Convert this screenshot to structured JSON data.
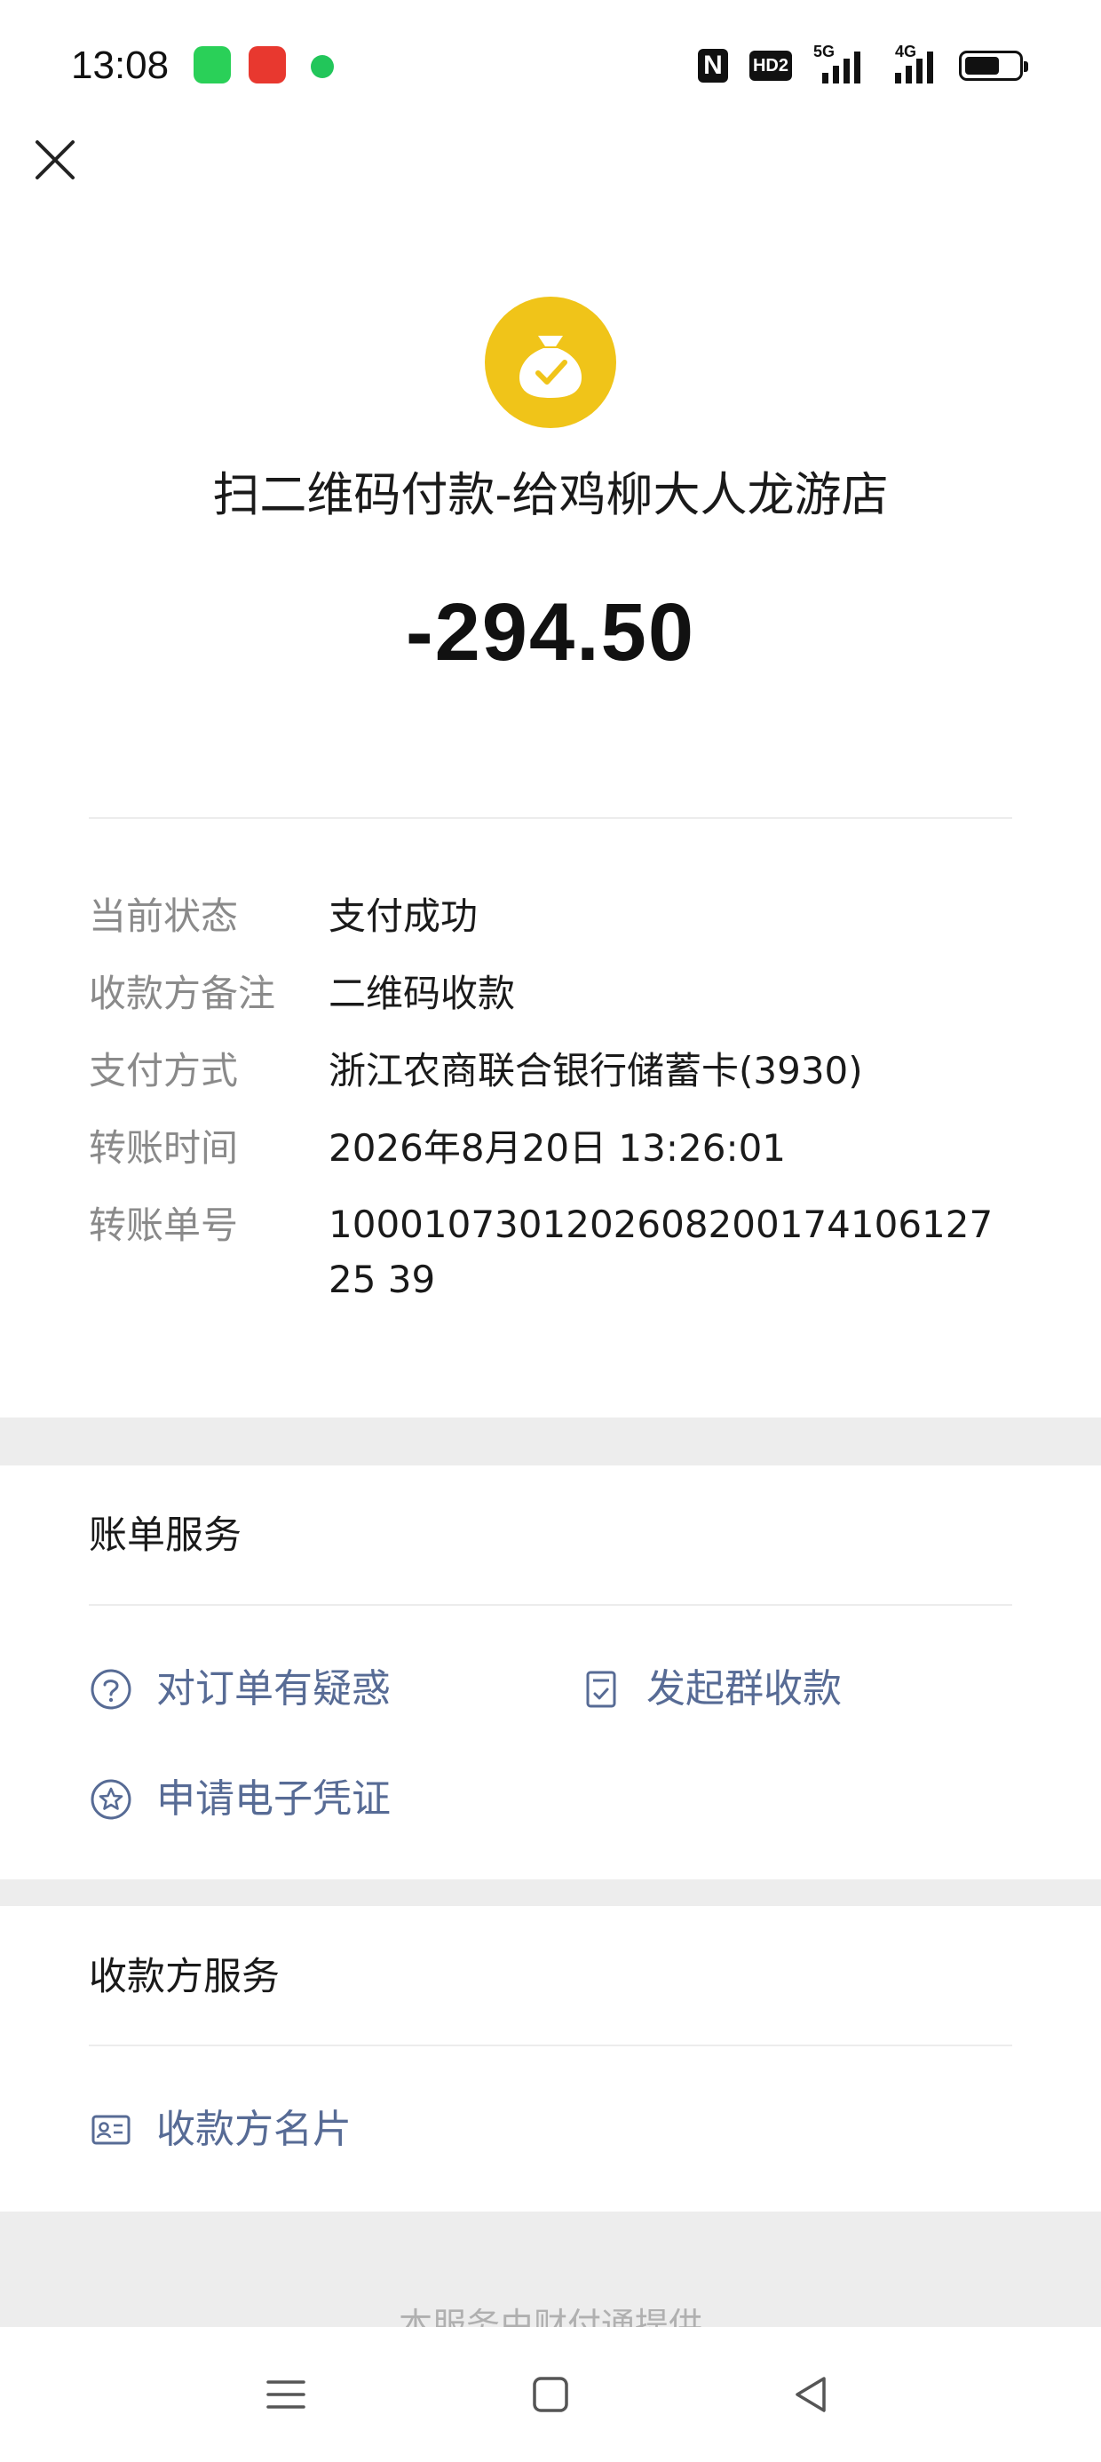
{
  "status_bar": {
    "time": "13:08",
    "hd_label": "HD2",
    "network_1": "5G",
    "network_2": "4G"
  },
  "header": {
    "close_icon": "close-icon",
    "hero_icon": "money-bag-check-icon",
    "title": "扫二维码付款-给鸡柳大人龙游店",
    "amount": "-294.50",
    "accent_color": "#f0c419"
  },
  "details": [
    {
      "label": "当前状态",
      "value": "支付成功"
    },
    {
      "label": "收款方备注",
      "value": "二维码收款"
    },
    {
      "label": "支付方式",
      "value": "浙江农商联合银行储蓄卡(3930)"
    },
    {
      "label": "转账时间",
      "value": "2026年8月20日 13:26:01"
    },
    {
      "label": "转账单号",
      "value": "100010730120260820017410612725 39"
    }
  ],
  "bill_service": {
    "title": "账单服务",
    "actions": [
      {
        "label": "对订单有疑惑",
        "icon": "question-circle-icon"
      },
      {
        "label": "发起群收款",
        "icon": "document-check-icon"
      },
      {
        "label": "申请电子凭证",
        "icon": "star-badge-icon"
      }
    ]
  },
  "payee_service": {
    "title": "收款方服务",
    "actions": [
      {
        "label": "收款方名片",
        "icon": "contact-card-icon"
      }
    ]
  },
  "footer": {
    "note": "本服务由财付通提供"
  },
  "link_color": "#576b95",
  "nav": {
    "menu_icon": "menu-icon",
    "home_icon": "home-square-icon",
    "back_icon": "back-triangle-icon"
  }
}
